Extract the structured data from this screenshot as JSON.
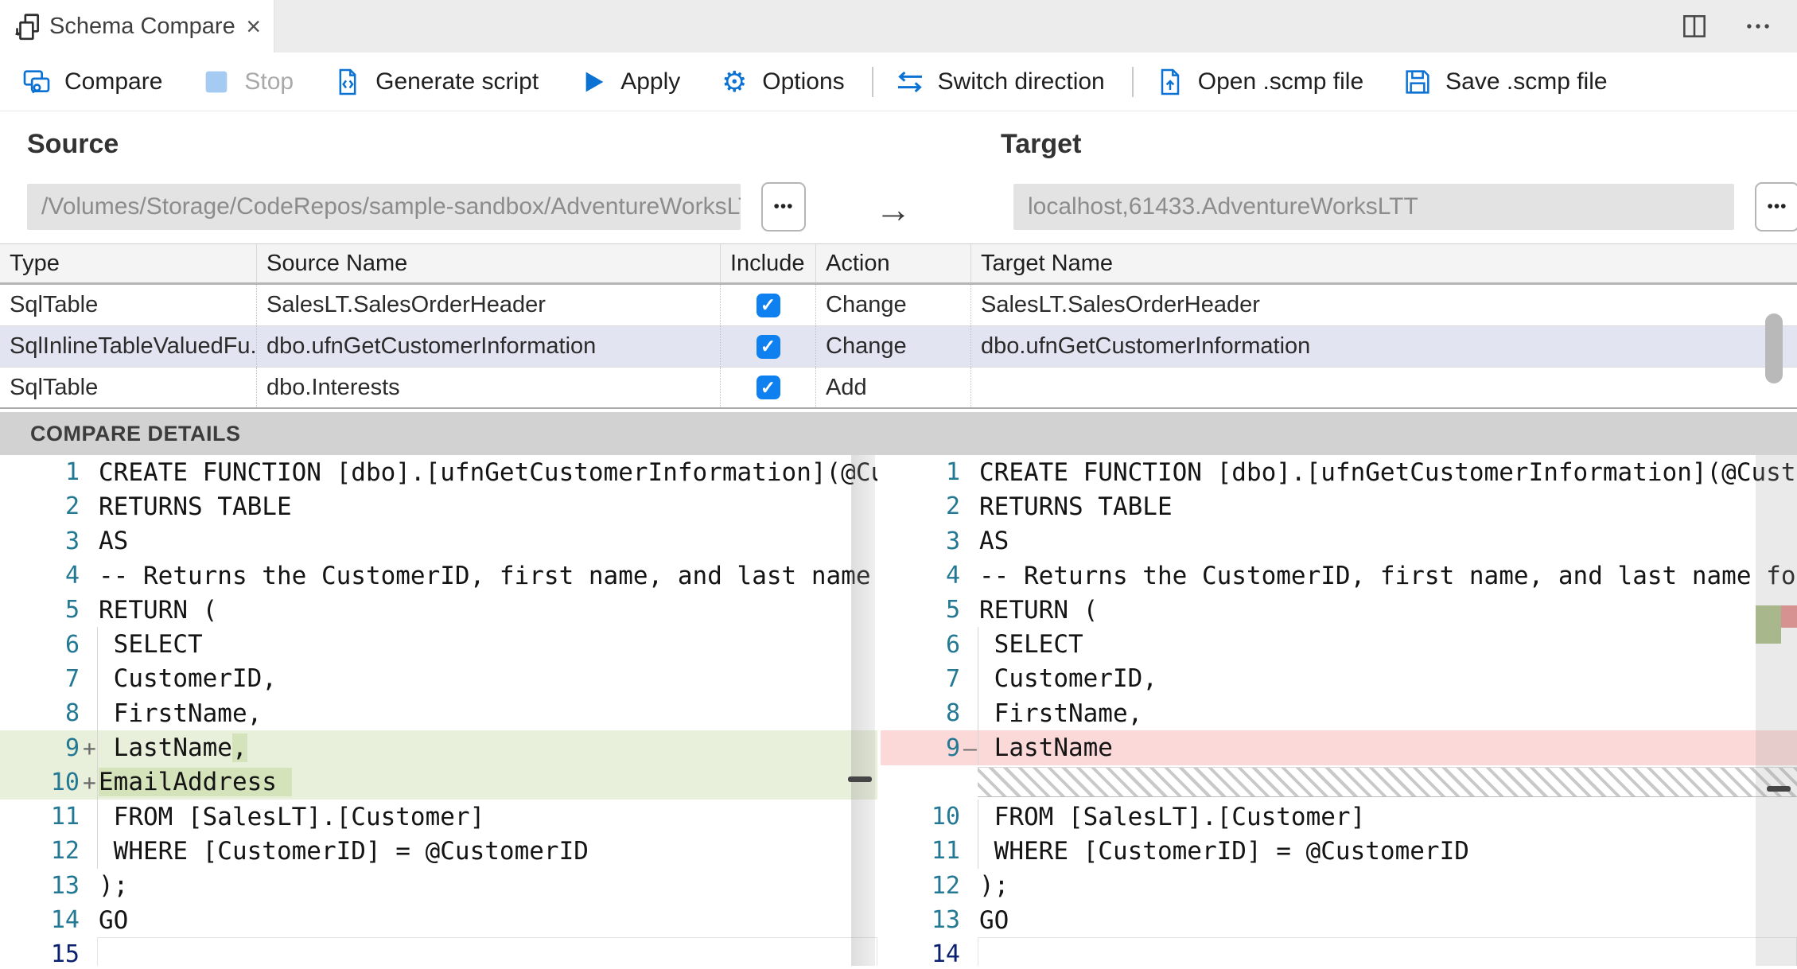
{
  "tab": {
    "title": "Schema Compare",
    "close_glyph": "×"
  },
  "toolbar": {
    "items": [
      {
        "id": "compare",
        "label": "Compare",
        "icon": "compare",
        "enabled": true
      },
      {
        "id": "stop",
        "label": "Stop",
        "icon": "stop",
        "enabled": false
      },
      {
        "id": "generate-script",
        "label": "Generate script",
        "icon": "script",
        "enabled": true
      },
      {
        "id": "apply",
        "label": "Apply",
        "icon": "play",
        "enabled": true
      },
      {
        "id": "options",
        "label": "Options",
        "icon": "gear",
        "enabled": true
      },
      {
        "id": "sep1",
        "separator": true
      },
      {
        "id": "switch-direction",
        "label": "Switch direction",
        "icon": "switch",
        "enabled": true
      },
      {
        "id": "sep2",
        "separator": true
      },
      {
        "id": "open-scmp",
        "label": "Open .scmp file",
        "icon": "open",
        "enabled": true
      },
      {
        "id": "save-scmp",
        "label": "Save .scmp file",
        "icon": "save",
        "enabled": true
      }
    ]
  },
  "source": {
    "heading": "Source",
    "value": "/Volumes/Storage/CodeRepos/sample-sandbox/AdventureWorksLT-n...",
    "browse_glyph": "•••"
  },
  "target": {
    "heading": "Target",
    "value": "localhost,61433.AdventureWorksLTT",
    "browse_glyph": "•••"
  },
  "direction_arrow": "→",
  "grid": {
    "check_glyph": "✓",
    "columns": [
      "Type",
      "Source Name",
      "Include",
      "Action",
      "Target Name"
    ],
    "rows": [
      {
        "type": "SqlTable",
        "source": "SalesLT.SalesOrderHeader",
        "include": true,
        "action": "Change",
        "target": "SalesLT.SalesOrderHeader",
        "selected": false
      },
      {
        "type": "SqlInlineTableValuedFu...",
        "source": "dbo.ufnGetCustomerInformation",
        "include": true,
        "action": "Change",
        "target": "dbo.ufnGetCustomerInformation",
        "selected": true
      },
      {
        "type": "SqlTable",
        "source": "dbo.Interests",
        "include": true,
        "action": "Add",
        "target": "",
        "selected": false
      }
    ]
  },
  "details": {
    "heading": "COMPARE DETAILS"
  },
  "diff": {
    "left": [
      {
        "n": 1,
        "text": "CREATE FUNCTION [dbo].[ufnGetCustomerInformation](@Custo"
      },
      {
        "n": 2,
        "text": "RETURNS TABLE"
      },
      {
        "n": 3,
        "text": "AS"
      },
      {
        "n": 4,
        "text": "-- Returns the CustomerID, first name, and last name for"
      },
      {
        "n": 5,
        "text": "RETURN ("
      },
      {
        "n": 6,
        "text": " SELECT",
        "guide": true
      },
      {
        "n": 7,
        "text": " CustomerID,",
        "guide": true
      },
      {
        "n": 8,
        "text": " FirstName,",
        "guide": true
      },
      {
        "n": 9,
        "text": " LastName,",
        "marker": "+",
        "kind": "add",
        "hl": [
          [
            9,
            10
          ]
        ],
        "guide": true
      },
      {
        "n": 10,
        "text": " EmailAddress ",
        "marker": "+",
        "kind": "add",
        "hl": [
          [
            1,
            14
          ]
        ],
        "guide": true
      },
      {
        "n": 11,
        "text": " FROM [SalesLT].[Customer]",
        "guide": true
      },
      {
        "n": 12,
        "text": " WHERE [CustomerID] = @CustomerID",
        "guide": true
      },
      {
        "n": 13,
        "text": ");"
      },
      {
        "n": 14,
        "text": "GO"
      },
      {
        "n": 15,
        "text": "",
        "current": true
      }
    ],
    "right": [
      {
        "n": 1,
        "text": "CREATE FUNCTION [dbo].[ufnGetCustomerInformation](@Custo"
      },
      {
        "n": 2,
        "text": "RETURNS TABLE"
      },
      {
        "n": 3,
        "text": "AS"
      },
      {
        "n": 4,
        "text": "-- Returns the CustomerID, first name, and last name for"
      },
      {
        "n": 5,
        "text": "RETURN ("
      },
      {
        "n": 6,
        "text": " SELECT",
        "guide": true
      },
      {
        "n": 7,
        "text": " CustomerID,",
        "guide": true
      },
      {
        "n": 8,
        "text": " FirstName,",
        "guide": true
      },
      {
        "n": 9,
        "text": " LastName",
        "marker": "–",
        "kind": "del",
        "guide": true
      },
      {
        "gap": true
      },
      {
        "n": 10,
        "text": " FROM [SalesLT].[Customer]",
        "guide": true
      },
      {
        "n": 11,
        "text": " WHERE [CustomerID] = @CustomerID",
        "guide": true
      },
      {
        "n": 12,
        "text": ");"
      },
      {
        "n": 13,
        "text": "GO"
      },
      {
        "n": 14,
        "text": "",
        "current": true
      }
    ]
  },
  "colors": {
    "accent": "#0b72d4",
    "checkbox": "#0f80f0",
    "add_line": "#e8efdb",
    "add_char": "#d5e3bb",
    "del_line": "#fbd9d9",
    "line_number": "#237893",
    "active_line_number": "#0b216f",
    "selected_row": "#e2e4f2",
    "details_bg": "#d2d2d2"
  }
}
